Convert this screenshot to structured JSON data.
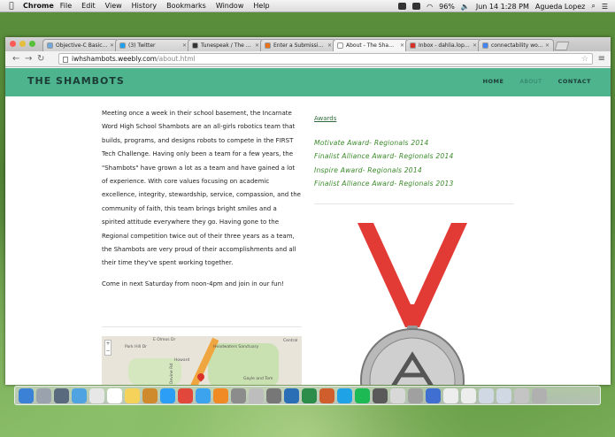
{
  "menubar": {
    "app": "Chrome",
    "items": [
      "File",
      "Edit",
      "View",
      "History",
      "Bookmarks",
      "Window",
      "Help"
    ],
    "battery": "96%",
    "clock": "Jun 14  1:28 PM",
    "user": "Agueda Lopez"
  },
  "browser": {
    "tabs": [
      {
        "title": "Objective-C Basics Dev",
        "favicon_color": "#6fa8dc",
        "active": false
      },
      {
        "title": "(3) Twitter",
        "favicon_color": "#1da1f2",
        "active": false
      },
      {
        "title": "Tunespeak / The Ready",
        "favicon_color": "#333333",
        "active": false
      },
      {
        "title": "Enter a Submission | Sc",
        "favicon_color": "#e8711a",
        "active": false
      },
      {
        "title": "About - The Shambots",
        "favicon_color": "#ffffff",
        "active": true
      },
      {
        "title": "Inbox - dahlia.lopez@g",
        "favicon_color": "#d93025",
        "active": false
      },
      {
        "title": "connectability word - G",
        "favicon_color": "#4285f4",
        "active": false
      }
    ],
    "url_host": "iwhshambots.weebly.com",
    "url_path": "/about.html"
  },
  "site": {
    "title": "THE SHAMBOTS",
    "nav": [
      {
        "label": "HOME",
        "current": false
      },
      {
        "label": "ABOUT",
        "current": true
      },
      {
        "label": "CONTACT",
        "current": false
      }
    ],
    "about_paragraph": "Meeting once a week in their school basement, the Incarnate Word High School Shambots are an all-girls robotics team that builds, programs, and designs robots to compete in the FIRST Tech Challenge. Having only been a team for a few years, the \"Shambots\" have grown a lot as a team and have gained a lot of experience. With core values focusing on academic excellence, integrity, stewardship, service, compassion, and the community of faith, this team brings bright smiles and a spirited attitude everywhere they go. Having gone to the Regional competition twice out of their three years as a team, the Shambots are very proud of their accomplishments and all their time they've spent working together.",
    "invite": "Come in next Saturday from noon-4pm and join in our fun!",
    "awards_link": "Awards",
    "awards": [
      "Motivate Award- Regionals 2014",
      "Finalist Alliance Award- Regionals 2014",
      "Inspire Award- Regionals 2014",
      "Finalist Alliance Award- Regionals 2013"
    ],
    "map_labels": [
      "E Olmos Dr",
      "Park Hill Dr",
      "Headwaters Sanctuary",
      "Central",
      "Howard",
      "Gayle and Tom",
      "Devine Rd"
    ]
  },
  "colors": {
    "header_bg": "#4db48e",
    "award_text": "#3b8a2a",
    "ribbon": "#e23a35"
  }
}
